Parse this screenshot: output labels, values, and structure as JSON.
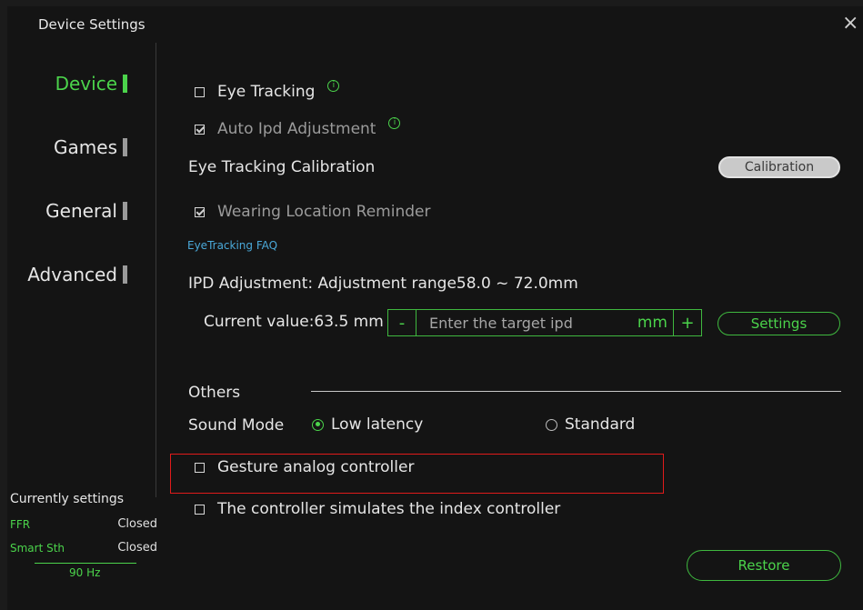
{
  "window": {
    "title": "Device Settings",
    "close_glyph": "×"
  },
  "sidebar": {
    "items": [
      {
        "label": "Device",
        "active": true
      },
      {
        "label": "Games",
        "active": false
      },
      {
        "label": "General",
        "active": false
      },
      {
        "label": "Advanced",
        "active": false
      }
    ]
  },
  "device": {
    "eye_tracking": {
      "label": "Eye Tracking",
      "checked": false,
      "info_icon": "info-icon"
    },
    "auto_ipd": {
      "label": "Auto Ipd Adjustment",
      "checked": true,
      "info_icon": "info-icon"
    },
    "calibration": {
      "label": "Eye Tracking Calibration",
      "button_label": "Calibration"
    },
    "wearing_reminder": {
      "label": "Wearing Location Reminder",
      "checked": true
    },
    "faq_link": "EyeTracking FAQ",
    "ipd": {
      "heading": "IPD Adjustment: Adjustment range58.0 ~ 72.0mm",
      "current_label": "Current value:63.5 mm",
      "minus": "-",
      "plus": "+",
      "placeholder": "Enter the target ipd",
      "unit": "mm",
      "settings_label": "Settings"
    }
  },
  "others": {
    "heading": "Others",
    "sound_mode": {
      "label": "Sound Mode",
      "options": [
        {
          "label": "Low latency",
          "selected": true
        },
        {
          "label": "Standard",
          "selected": false
        }
      ]
    },
    "gesture": {
      "label": "Gesture analog controller",
      "checked": false
    },
    "index_sim": {
      "label": "The controller simulates the index controller",
      "checked": false
    }
  },
  "status": {
    "title": "Currently settings",
    "rows": [
      {
        "label": "FFR",
        "value": "Closed"
      },
      {
        "label": "Smart Sth",
        "value": "Closed"
      }
    ],
    "refresh": "90 Hz"
  },
  "footer": {
    "restore_label": "Restore"
  },
  "colors": {
    "accent": "#4bd34b",
    "link": "#4aa8d8",
    "highlight": "#e01b1b",
    "background": "#141414"
  }
}
